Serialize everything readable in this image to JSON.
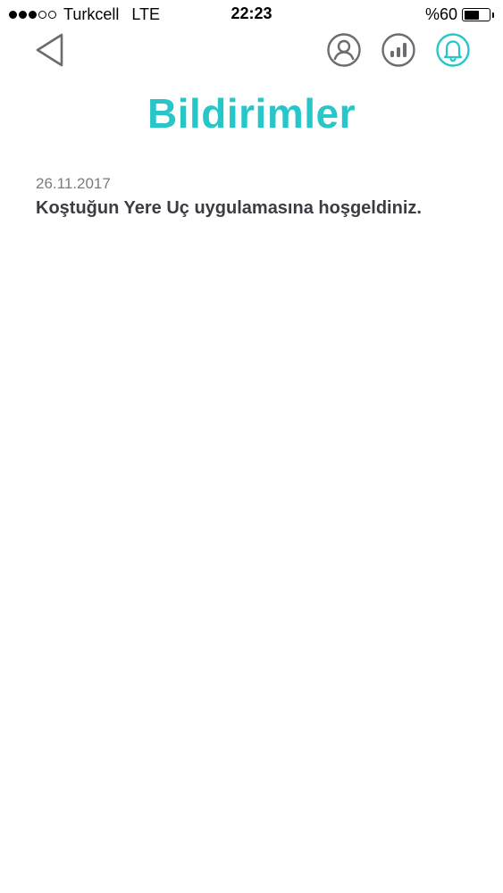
{
  "status_bar": {
    "carrier": "Turkcell",
    "network": "LTE",
    "time": "22:23",
    "battery": "%60",
    "battery_level": 0.6,
    "signal_filled": 3,
    "signal_total": 5
  },
  "nav": {
    "back_icon": "back-triangle-icon",
    "icons": [
      "profile-icon",
      "stats-icon",
      "notification-bell-icon"
    ],
    "active_icon": "notification-bell-icon"
  },
  "colors": {
    "accent": "#27c6c8",
    "icon_gray": "#6b6b70",
    "text_dark": "#3c3c44",
    "text_muted": "#7a7a80"
  },
  "page": {
    "title": "Bildirimler"
  },
  "notifications": [
    {
      "date": "26.11.2017",
      "message": "Koştuğun Yere Uç uygulamasına hoşgeldiniz."
    }
  ]
}
